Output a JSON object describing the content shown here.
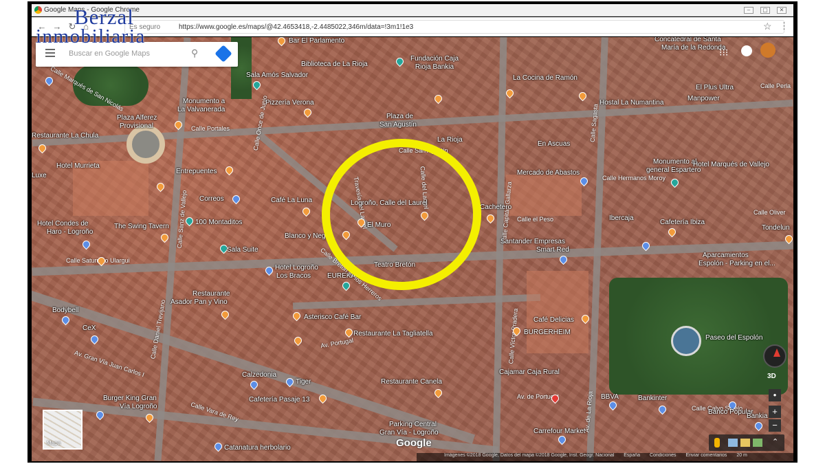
{
  "window": {
    "title": "Google Maps - Google Chrome"
  },
  "browser": {
    "security_text": "Es seguro",
    "url": "https://www.google.es/maps/@42.4653418,-2.4485022,346m/data=!3m1!1e3"
  },
  "branding": {
    "logo_line1": "Berzal",
    "logo_line2": "inmobiliaria"
  },
  "search": {
    "placeholder": "Buscar en Google Maps"
  },
  "map": {
    "view_type_label": "Mapa",
    "mode_3d": "3D",
    "zoom_in": "+",
    "zoom_out": "−",
    "google_logo": "Google",
    "footer": {
      "attribution": "Imágenes ©2018 Google, Datos del mapa ©2018 Google, Inst. Geogr. Nacional",
      "country": "España",
      "terms": "Condiciones",
      "feedback": "Enviar comentarios",
      "scale": "20 m"
    },
    "places": [
      "Bar El Parlamento",
      "Biblioteca de La Rioja",
      "Fundación Caja Rioja Bankia",
      "Concatedral de Santa",
      "María de la Redonda",
      "Sala Amós Salvador",
      "La Cocina de Ramón",
      "El Plus Ultra",
      "Monumento a",
      "La Valvanerada",
      "Pizzería Verona",
      "Hostal La Numantina",
      "Manpower",
      "Plaza Alferez",
      "Provisional",
      "Plaza de",
      "San Agustín",
      "Restaurante La Chula",
      "La Rioja",
      "En Ascuas",
      "Monumento al",
      "general Espartero",
      "Hotel Murrieta",
      "Entrepuentes",
      "Mercado de Abastos",
      "Hotel Marqués de Vallejo",
      "Luxe",
      "Correos",
      "Café La Luna",
      "Logroño, Calle del Laurel",
      "Cachetero",
      "Hotel Condes de",
      "Haro - Logroño",
      "The Swing Tavern",
      "100 Montaditos",
      "El Muro",
      "Ibercaja",
      "Cafetería Ibiza",
      "Tondelun",
      "Blanco y Negro",
      "Santander Empresas",
      "Smart Red",
      "Sala Suite",
      "Aparcamientos",
      "Espolón - Parking en el...",
      "Hotel Logroño",
      "Los Bracos",
      "EUREKA",
      "Teatro Bretón",
      "Restaurante",
      "Asador Pan y Vino",
      "Bodybell",
      "Asterisco Café Bar",
      "Café Delicias",
      "CeX",
      "BURGERHEIM",
      "Restaurante La Tagliatella",
      "Paseo del Espolón",
      "Calzedonia",
      "Tiger",
      "Restaurante Canela",
      "Cajamar Caja Rural",
      "Burger King Gran",
      "Vía Logroño",
      "Cafetería Pasaje 13",
      "BBVA",
      "Bankinter",
      "Banco Popular",
      "Parking Central",
      "Gran Vía - Logroño",
      "Carrefour Market",
      "Bankia",
      "Catanatura herbolario"
    ],
    "streets": [
      "Calle Marqués de San Nicolás",
      "Calle Portales",
      "Calle Once de Junio",
      "Calle Sagasta",
      "Calle Hermanos Moroy",
      "Calle del Laurel",
      "Calle San Agustín",
      "Calle Capitán Gallarza",
      "Calle el Peso",
      "Calle Sanz de Vallejo",
      "Calle Saturnino Ulargui",
      "Calle Oliver",
      "Calle Bretón de los Herreros",
      "Calle Daniel Trevijano",
      "Travesía del Laurel",
      "Av. Portugal",
      "Av. Gran Vía Juan Carlos I",
      "Calle Víctor Pradera",
      "Av. de Portugal",
      "Av. de La Rioja",
      "Calle Calvo Sotelo",
      "Calle Vara de Rey",
      "Calle Perla"
    ]
  }
}
